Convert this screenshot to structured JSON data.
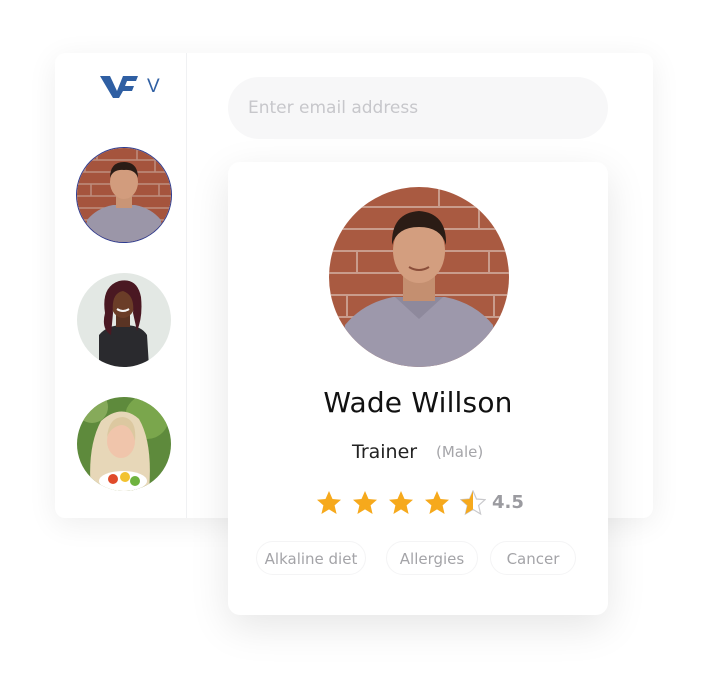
{
  "brand": {
    "logo_letter": "V",
    "accent": "#2f5fa3"
  },
  "sidebar": {
    "avatars": [
      {
        "name": "Wade Willson",
        "selected": true
      },
      {
        "name": "trainer-2",
        "selected": false
      },
      {
        "name": "trainer-3",
        "selected": false
      }
    ]
  },
  "search": {
    "placeholder": "Enter email address",
    "value": ""
  },
  "profile": {
    "name": "Wade Willson",
    "role": "Trainer",
    "gender": "(Male)",
    "rating_text": "4.5",
    "rating_value": 4.5,
    "rating_max": 5,
    "star_color": "#f6a91c",
    "tags": [
      "Alkaline diet",
      "Allergies",
      "Cancer"
    ]
  }
}
